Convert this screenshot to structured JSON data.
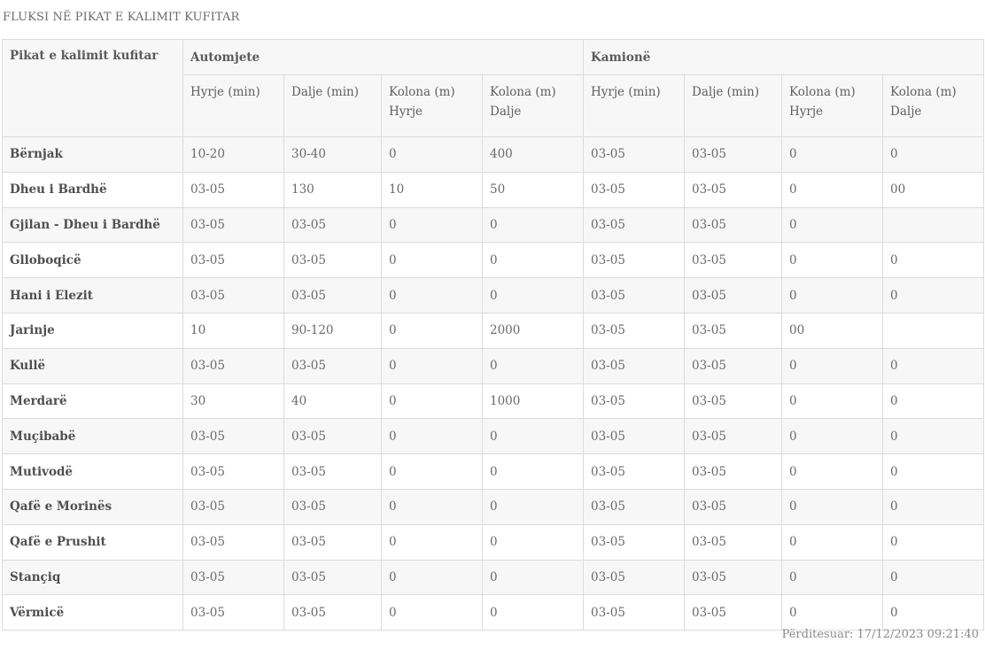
{
  "title": "FLUKSI NË PIKAT E KALIMIT KUFITAR",
  "table": {
    "first_header": "Pikat e kalimit kufitar",
    "groups": [
      "Automjete",
      "Kamionë"
    ],
    "sub_headers": [
      "Hyrje (min)",
      "Dalje (min)",
      "Kolona (m) Hyrje",
      "Kolona (m) Dalje",
      "Hyrje (min)",
      "Dalje (min)",
      "Kolona (m) Hyrje",
      "Kolona (m) Dalje"
    ],
    "rows": [
      {
        "name": "Bërnjak",
        "values": [
          "10-20",
          "30-40",
          "0",
          "400",
          "03-05",
          "03-05",
          "0",
          "0"
        ]
      },
      {
        "name": "Dheu i Bardhë",
        "values": [
          "03-05",
          "130",
          "10",
          "50",
          "03-05",
          "03-05",
          "0",
          "00"
        ]
      },
      {
        "name": "Gjilan - Dheu i Bardhë",
        "values": [
          "03-05",
          "03-05",
          "0",
          "0",
          "03-05",
          "03-05",
          "0",
          ""
        ]
      },
      {
        "name": "Glloboqicë",
        "values": [
          "03-05",
          "03-05",
          "0",
          "0",
          "03-05",
          "03-05",
          "0",
          "0"
        ]
      },
      {
        "name": "Hani i Elezit",
        "values": [
          "03-05",
          "03-05",
          "0",
          "0",
          "03-05",
          "03-05",
          "0",
          "0"
        ]
      },
      {
        "name": "Jarinje",
        "values": [
          "10",
          "90-120",
          "0",
          "2000",
          "03-05",
          "03-05",
          "00",
          ""
        ]
      },
      {
        "name": "Kullë",
        "values": [
          "03-05",
          "03-05",
          "0",
          "0",
          "03-05",
          "03-05",
          "0",
          "0"
        ]
      },
      {
        "name": "Merdarë",
        "values": [
          "30",
          "40",
          "0",
          "1000",
          "03-05",
          "03-05",
          "0",
          "0"
        ]
      },
      {
        "name": "Muçibabë",
        "values": [
          "03-05",
          "03-05",
          "0",
          "0",
          "03-05",
          "03-05",
          "0",
          "0"
        ]
      },
      {
        "name": "Mutivodë",
        "values": [
          "03-05",
          "03-05",
          "0",
          "0",
          "03-05",
          "03-05",
          "0",
          "0"
        ]
      },
      {
        "name": "Qafë e Morinës",
        "values": [
          "03-05",
          "03-05",
          "0",
          "0",
          "03-05",
          "03-05",
          "0",
          "0"
        ]
      },
      {
        "name": "Qafë e Prushit",
        "values": [
          "03-05",
          "03-05",
          "0",
          "0",
          "03-05",
          "03-05",
          "0",
          "0"
        ]
      },
      {
        "name": "Stançiq",
        "values": [
          "03-05",
          "03-05",
          "0",
          "0",
          "03-05",
          "03-05",
          "0",
          "0"
        ]
      },
      {
        "name": "Vërmicë",
        "values": [
          "03-05",
          "03-05",
          "0",
          "0",
          "03-05",
          "03-05",
          "0",
          "0"
        ]
      }
    ]
  },
  "updated": "Përditesuar: 17/12/2023 09:21:40"
}
